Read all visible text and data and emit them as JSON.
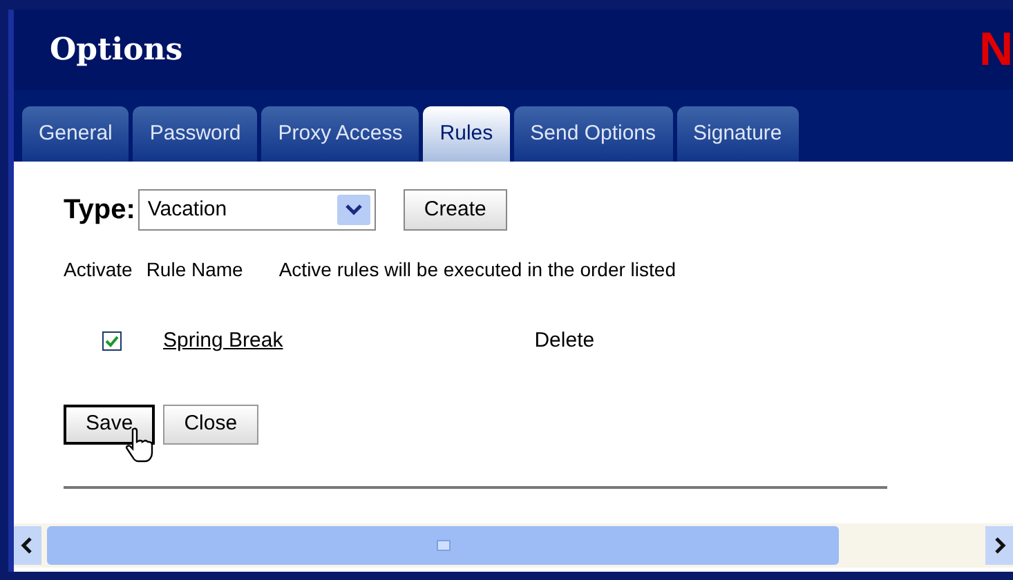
{
  "window": {
    "title": "Options",
    "logo": "N"
  },
  "tabs": [
    {
      "label": "General",
      "selected": false
    },
    {
      "label": "Password",
      "selected": false
    },
    {
      "label": "Proxy Access",
      "selected": false
    },
    {
      "label": "Rules",
      "selected": true
    },
    {
      "label": "Send Options",
      "selected": false
    },
    {
      "label": "Signature",
      "selected": false
    }
  ],
  "type_label": "Type:",
  "type_select": {
    "value": "Vacation"
  },
  "create_button": "Create",
  "columns": [
    "Activate",
    "Rule Name",
    "Active rules will be executed in the order listed"
  ],
  "rules": [
    {
      "name": "Spring Break",
      "checked": true,
      "action": "Delete"
    }
  ],
  "buttons": [
    "Save",
    "Close"
  ]
}
